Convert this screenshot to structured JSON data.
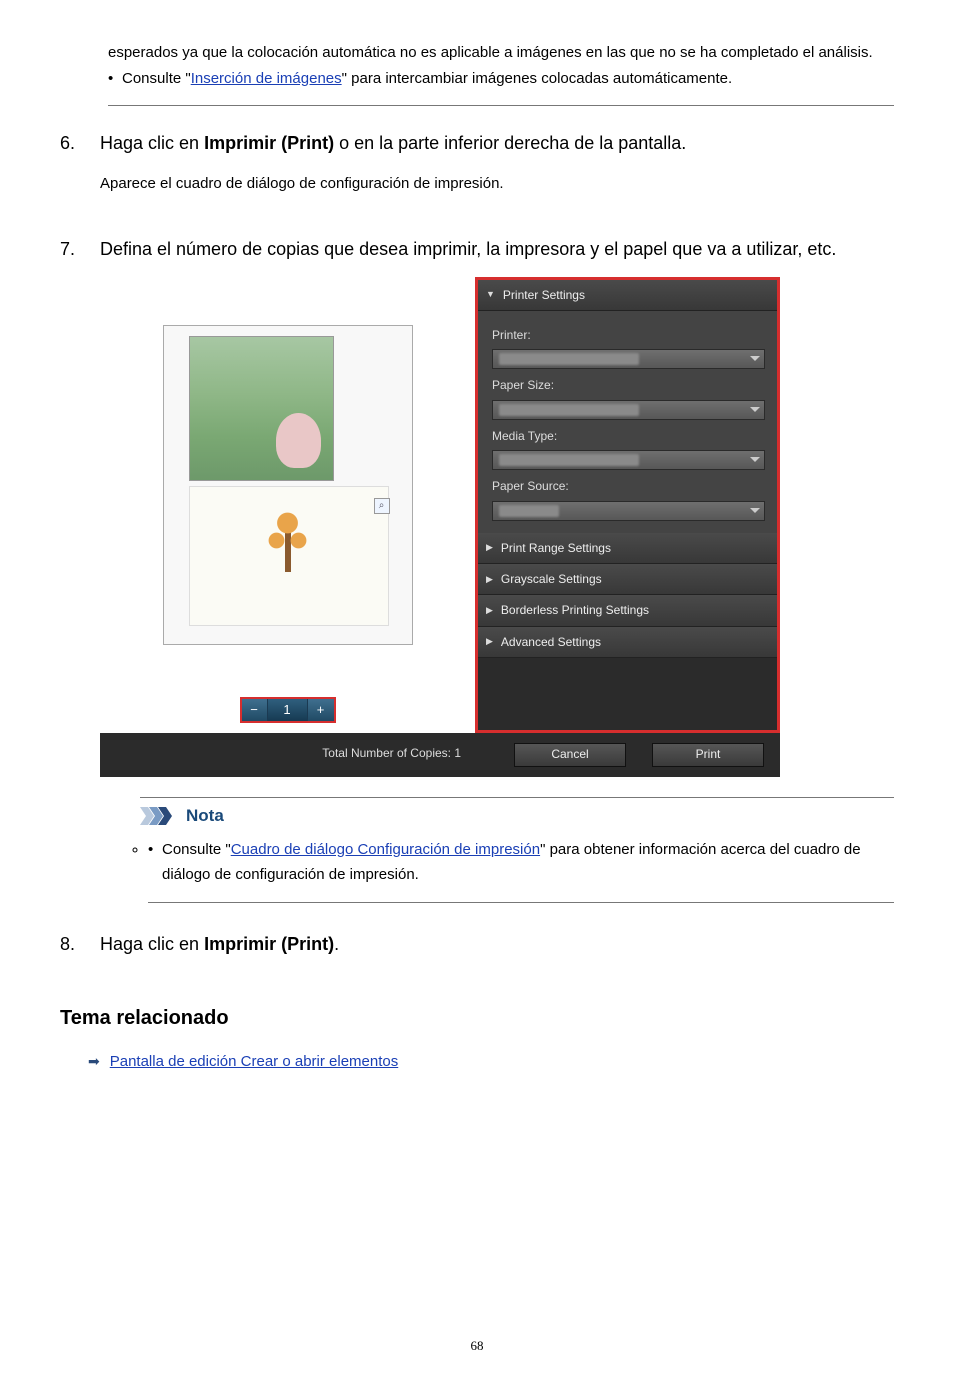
{
  "noteTop": {
    "line1": "esperados ya que la colocación automática no es aplicable a imágenes en las que no se ha completado el análisis.",
    "bulletPrefix": "Consulte \"",
    "bulletLink": "Inserción de imágenes",
    "bulletSuffix": "\" para intercambiar imágenes colocadas automáticamente."
  },
  "step6": {
    "num": "6.",
    "pre": "Haga clic en ",
    "bold": "Imprimir (Print)",
    "post": " o en la parte inferior derecha de la pantalla.",
    "sub": "Aparece el cuadro de diálogo de configuración de impresión."
  },
  "step7": {
    "num": "7.",
    "text": "Defina el número de copias que desea imprimir, la impresora y el papel que va a utilizar, etc."
  },
  "figure": {
    "copies_minus": "−",
    "copies_value": "1",
    "copies_plus": "+",
    "total_label": "Total Number of Copies: 1",
    "right": {
      "printerSettings": "Printer Settings",
      "printer": "Printer:",
      "paperSize": "Paper Size:",
      "mediaType": "Media Type:",
      "paperSource": "Paper Source:",
      "printRange": "Print Range Settings",
      "grayscale": "Grayscale Settings",
      "borderless": "Borderless Printing Settings",
      "advanced": "Advanced Settings"
    },
    "cancel": "Cancel",
    "print": "Print"
  },
  "nota": {
    "label": "Nota",
    "bulletPrefix": "Consulte \"",
    "bulletLink": "Cuadro de diálogo Configuración de impresión",
    "bulletSuffix": "\" para obtener información acerca del cuadro de diálogo de configuración de impresión."
  },
  "step8": {
    "num": "8.",
    "pre": "Haga clic en ",
    "bold": "Imprimir (Print)",
    "post": "."
  },
  "related": {
    "heading": "Tema relacionado",
    "link": "Pantalla de edición Crear o abrir elementos"
  },
  "pageNumber": "68"
}
